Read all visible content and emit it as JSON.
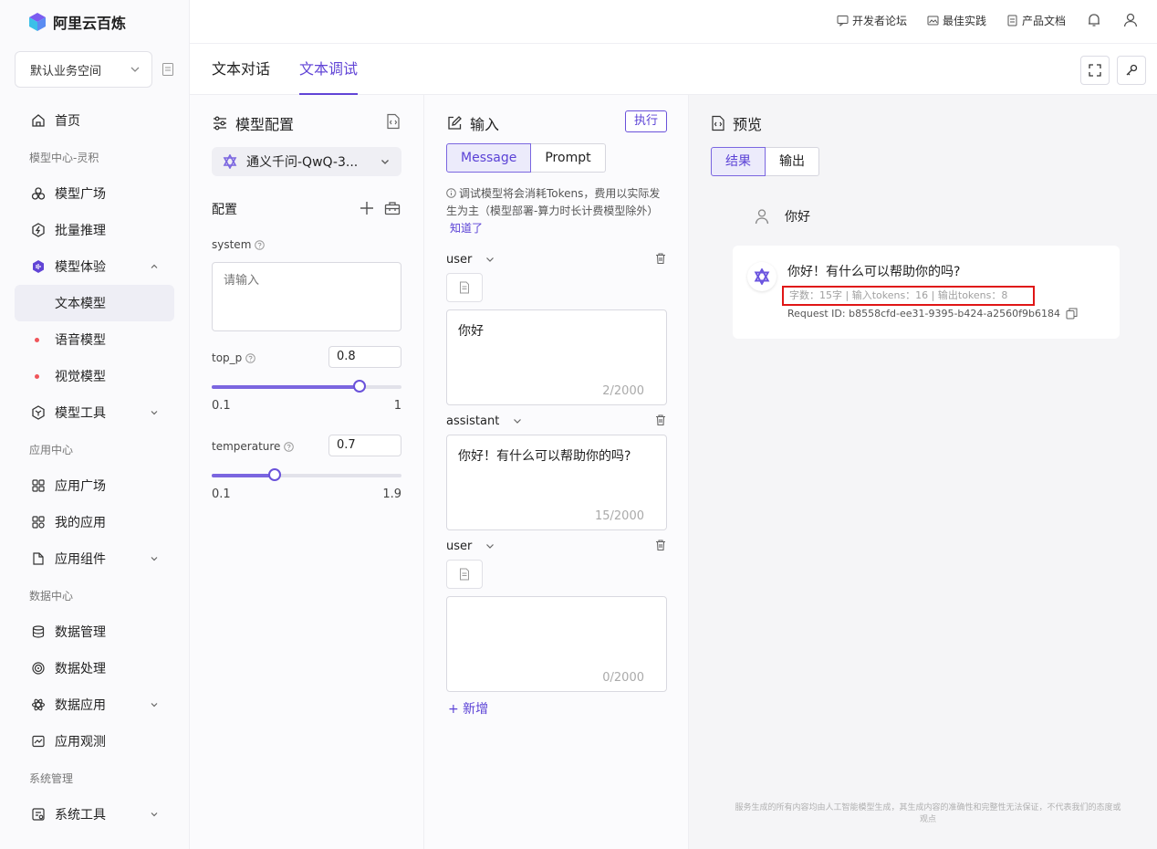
{
  "app": {
    "name": "阿里云百炼"
  },
  "workspace": {
    "label": "默认业务空间"
  },
  "sidebar": {
    "items": [
      {
        "label": "首页"
      },
      {
        "group": "模型中心-灵积"
      },
      {
        "label": "模型广场"
      },
      {
        "label": "批量推理"
      },
      {
        "label": "模型体验"
      },
      {
        "label": "文本模型"
      },
      {
        "label": "语音模型"
      },
      {
        "label": "视觉模型"
      },
      {
        "label": "模型工具"
      },
      {
        "group": "应用中心"
      },
      {
        "label": "应用广场"
      },
      {
        "label": "我的应用"
      },
      {
        "label": "应用组件"
      },
      {
        "group": "数据中心"
      },
      {
        "label": "数据管理"
      },
      {
        "label": "数据处理"
      },
      {
        "label": "数据应用"
      },
      {
        "label": "应用观测"
      },
      {
        "group": "系统管理"
      },
      {
        "label": "系统工具"
      }
    ]
  },
  "header": {
    "links": [
      "开发者论坛",
      "最佳实践",
      "产品文档"
    ]
  },
  "tabs": [
    "文本对话",
    "文本调试"
  ],
  "config": {
    "title": "模型配置",
    "model": "通义千问-QwQ-3...",
    "section": "配置",
    "system_label": "system",
    "system_placeholder": "请输入",
    "top_p": {
      "label": "top_p",
      "value": "0.8",
      "min": "0.1",
      "max": "1",
      "fraction": 0.78
    },
    "temperature": {
      "label": "temperature",
      "value": "0.7",
      "min": "0.1",
      "max": "1.9",
      "fraction": 0.33
    }
  },
  "input": {
    "title": "输入",
    "run": "执行",
    "modes": [
      "Message",
      "Prompt"
    ],
    "notice": "调试模型将会消耗Tokens，费用以实际发生为主（模型部署-算力时长计费模型除外）",
    "notice_link": "知道了",
    "messages": [
      {
        "role": "user",
        "text": "你好",
        "count": "2/2000"
      },
      {
        "role": "assistant",
        "text": "你好！有什么可以帮助你的吗?",
        "count": "15/2000"
      },
      {
        "role": "user",
        "text": "",
        "count": "0/2000"
      }
    ],
    "add": "+ 新增"
  },
  "preview": {
    "title": "预览",
    "tabs": [
      "结果",
      "输出"
    ],
    "user_message": "你好",
    "answer": "你好！有什么可以帮助你的吗?",
    "stats": "字数：15字 | 输入tokens：16 | 输出tokens：8",
    "request_id": "Request ID: b8558cfd-ee31-9395-b424-a2560f9b6184",
    "disclaimer": "服务生成的所有内容均由人工智能模型生成，其生成内容的准确性和完整性无法保证，不代表我们的态度或观点"
  },
  "colors": {
    "accent": "#6144d6",
    "highlight": "#e01616"
  }
}
